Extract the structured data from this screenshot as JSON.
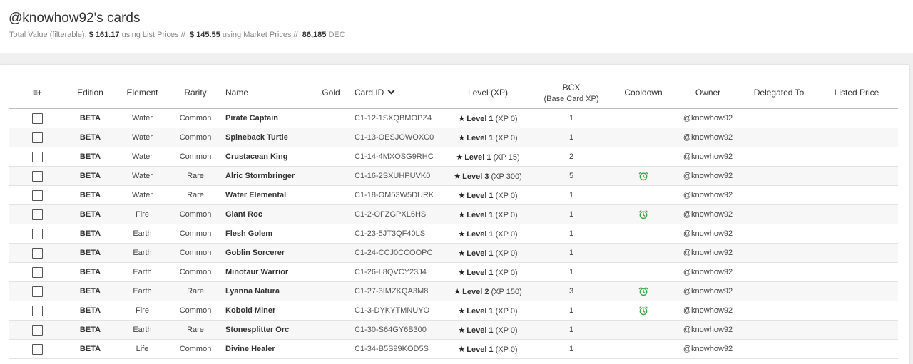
{
  "header": {
    "title": "@knowhow92's cards",
    "summary_label": "Total Value (filterable):",
    "list_value": "$ 161.17",
    "list_suffix": "using List Prices //",
    "market_value": "$ 145.55",
    "market_suffix": "using Market Prices //",
    "dec_value": "86,185",
    "dec_suffix": "DEC"
  },
  "table": {
    "columns": {
      "menu": "≡+",
      "edition": "Edition",
      "element": "Element",
      "rarity": "Rarity",
      "name": "Name",
      "gold": "Gold",
      "card_id": "Card ID",
      "level": "Level (XP)",
      "bcx": "BCX",
      "bcx_sub": "(Base Card XP)",
      "cooldown": "Cooldown",
      "owner": "Owner",
      "delegated": "Delegated To",
      "listed": "Listed Price"
    },
    "rows": [
      {
        "edition": "BETA",
        "element": "Water",
        "rarity": "Common",
        "name": "Pirate Captain",
        "card_id": "C1-12-1SXQBMOPZ4",
        "level": "Level 1",
        "xp": "(XP 0)",
        "bcx": "1",
        "cooldown": false,
        "owner": "@knowhow92"
      },
      {
        "edition": "BETA",
        "element": "Water",
        "rarity": "Common",
        "name": "Spineback Turtle",
        "card_id": "C1-13-OESJOWOXC0",
        "level": "Level 1",
        "xp": "(XP 0)",
        "bcx": "1",
        "cooldown": false,
        "owner": "@knowhow92"
      },
      {
        "edition": "BETA",
        "element": "Water",
        "rarity": "Common",
        "name": "Crustacean King",
        "card_id": "C1-14-4MXOSG9RHC",
        "level": "Level 1",
        "xp": "(XP 15)",
        "bcx": "2",
        "cooldown": false,
        "owner": "@knowhow92"
      },
      {
        "edition": "BETA",
        "element": "Water",
        "rarity": "Rare",
        "name": "Alric Stormbringer",
        "card_id": "C1-16-2SXUHPUVK0",
        "level": "Level 3",
        "xp": "(XP 300)",
        "bcx": "5",
        "cooldown": true,
        "owner": "@knowhow92"
      },
      {
        "edition": "BETA",
        "element": "Water",
        "rarity": "Rare",
        "name": "Water Elemental",
        "card_id": "C1-18-OM53W5DURK",
        "level": "Level 1",
        "xp": "(XP 0)",
        "bcx": "1",
        "cooldown": false,
        "owner": "@knowhow92"
      },
      {
        "edition": "BETA",
        "element": "Fire",
        "rarity": "Common",
        "name": "Giant Roc",
        "card_id": "C1-2-OFZGPXL6HS",
        "level": "Level 1",
        "xp": "(XP 0)",
        "bcx": "1",
        "cooldown": true,
        "owner": "@knowhow92"
      },
      {
        "edition": "BETA",
        "element": "Earth",
        "rarity": "Common",
        "name": "Flesh Golem",
        "card_id": "C1-23-5JT3QF40LS",
        "level": "Level 1",
        "xp": "(XP 0)",
        "bcx": "1",
        "cooldown": false,
        "owner": "@knowhow92"
      },
      {
        "edition": "BETA",
        "element": "Earth",
        "rarity": "Common",
        "name": "Goblin Sorcerer",
        "card_id": "C1-24-CCJ0CCOOPC",
        "level": "Level 1",
        "xp": "(XP 0)",
        "bcx": "1",
        "cooldown": false,
        "owner": "@knowhow92"
      },
      {
        "edition": "BETA",
        "element": "Earth",
        "rarity": "Common",
        "name": "Minotaur Warrior",
        "card_id": "C1-26-L8QVCY23J4",
        "level": "Level 1",
        "xp": "(XP 0)",
        "bcx": "1",
        "cooldown": false,
        "owner": "@knowhow92"
      },
      {
        "edition": "BETA",
        "element": "Earth",
        "rarity": "Rare",
        "name": "Lyanna Natura",
        "card_id": "C1-27-3IMZKQA3M8",
        "level": "Level 2",
        "xp": "(XP 150)",
        "bcx": "3",
        "cooldown": true,
        "owner": "@knowhow92"
      },
      {
        "edition": "BETA",
        "element": "Fire",
        "rarity": "Common",
        "name": "Kobold Miner",
        "card_id": "C1-3-DYKYTMNUYO",
        "level": "Level 1",
        "xp": "(XP 0)",
        "bcx": "1",
        "cooldown": true,
        "owner": "@knowhow92"
      },
      {
        "edition": "BETA",
        "element": "Earth",
        "rarity": "Rare",
        "name": "Stonesplitter Orc",
        "card_id": "C1-30-S64GY6B300",
        "level": "Level 1",
        "xp": "(XP 0)",
        "bcx": "1",
        "cooldown": false,
        "owner": "@knowhow92"
      },
      {
        "edition": "BETA",
        "element": "Life",
        "rarity": "Common",
        "name": "Divine Healer",
        "card_id": "C1-34-B5S99KOD5S",
        "level": "Level 1",
        "xp": "(XP 0)",
        "bcx": "1",
        "cooldown": false,
        "owner": "@knowhow92"
      }
    ]
  },
  "icons": {
    "star": "★",
    "cooldown": "alarm-clock-icon"
  },
  "colors": {
    "cooldown": "#3aa845"
  }
}
